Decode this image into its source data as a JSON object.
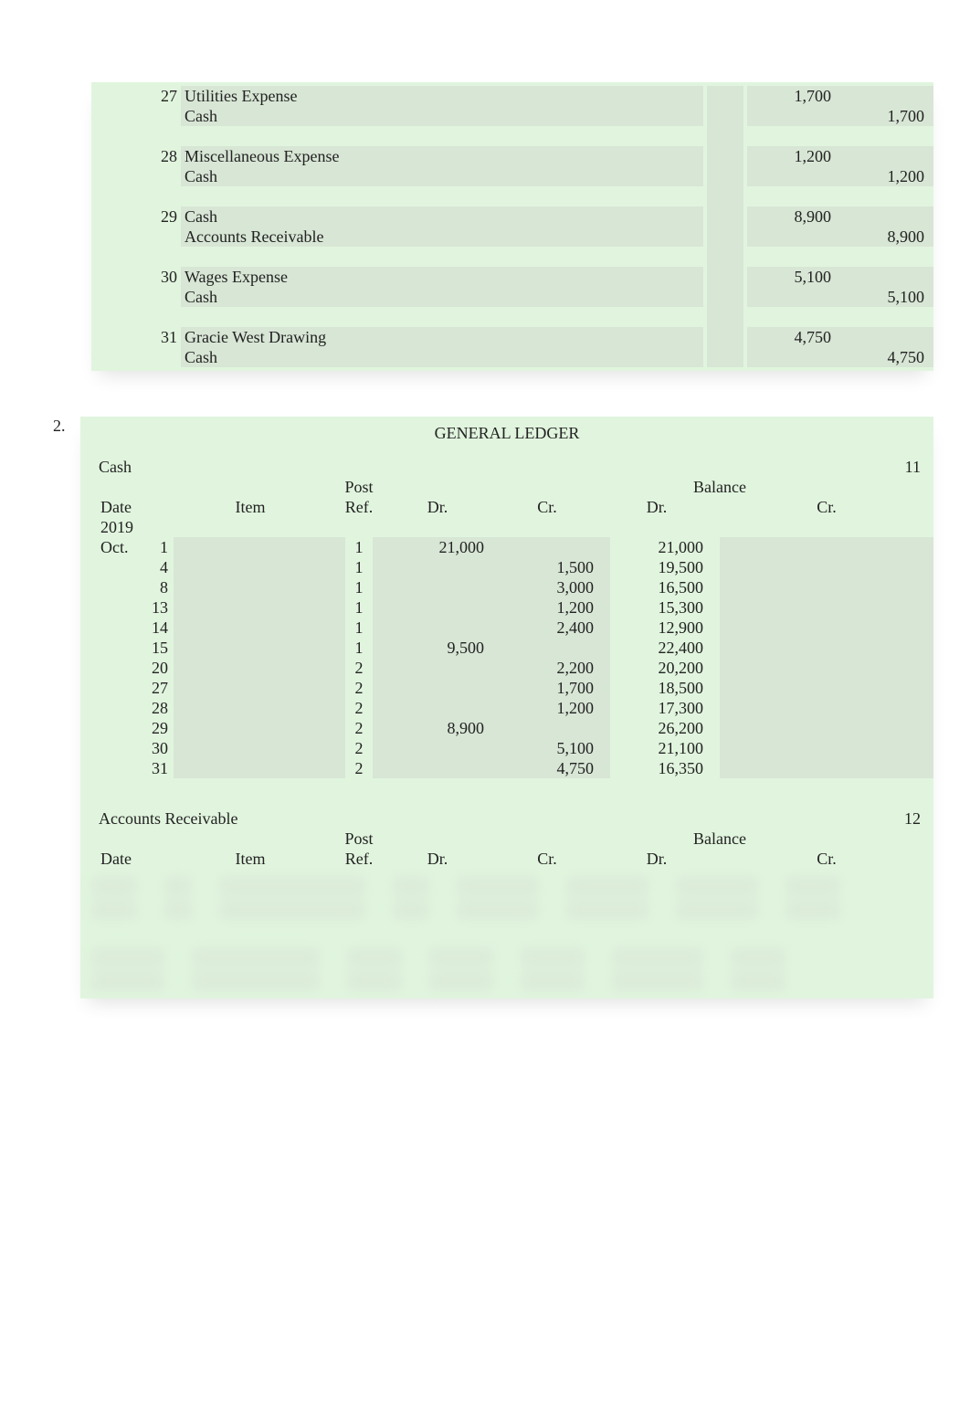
{
  "journal": {
    "entries": [
      {
        "day": "27",
        "debit_account": "Utilities Expense",
        "credit_account": "Cash",
        "amount_dr": "1,700",
        "amount_cr": "1,700"
      },
      {
        "day": "28",
        "debit_account": "Miscellaneous Expense",
        "credit_account": "Cash",
        "amount_dr": "1,200",
        "amount_cr": "1,200"
      },
      {
        "day": "29",
        "debit_account": "Cash",
        "credit_account": "Accounts Receivable",
        "amount_dr": "8,900",
        "amount_cr": "8,900"
      },
      {
        "day": "30",
        "debit_account": "Wages Expense",
        "credit_account": "Cash",
        "amount_dr": "5,100",
        "amount_cr": "5,100"
      },
      {
        "day": "31",
        "debit_account": "Gracie West Drawing",
        "credit_account": "Cash",
        "amount_dr": "4,750",
        "amount_cr": "4,750"
      }
    ]
  },
  "ledger": {
    "section_number": "2.",
    "title": "GENERAL LEDGER",
    "headers": {
      "date": "Date",
      "item": "Item",
      "post_ref": "Post Ref.",
      "post": "Post",
      "ref": "Ref.",
      "dr": "Dr.",
      "cr": "Cr.",
      "balance": "Balance"
    },
    "year": "2019",
    "month": "Oct.",
    "accounts": [
      {
        "name": "Cash",
        "number": "11",
        "rows": [
          {
            "day": "1",
            "ref": "1",
            "dr": "21,000",
            "cr": "",
            "bdr": "21,000",
            "bcr": ""
          },
          {
            "day": "4",
            "ref": "1",
            "dr": "",
            "cr": "1,500",
            "bdr": "19,500",
            "bcr": ""
          },
          {
            "day": "8",
            "ref": "1",
            "dr": "",
            "cr": "3,000",
            "bdr": "16,500",
            "bcr": ""
          },
          {
            "day": "13",
            "ref": "1",
            "dr": "",
            "cr": "1,200",
            "bdr": "15,300",
            "bcr": ""
          },
          {
            "day": "14",
            "ref": "1",
            "dr": "",
            "cr": "2,400",
            "bdr": "12,900",
            "bcr": ""
          },
          {
            "day": "15",
            "ref": "1",
            "dr": "9,500",
            "cr": "",
            "bdr": "22,400",
            "bcr": ""
          },
          {
            "day": "20",
            "ref": "2",
            "dr": "",
            "cr": "2,200",
            "bdr": "20,200",
            "bcr": ""
          },
          {
            "day": "27",
            "ref": "2",
            "dr": "",
            "cr": "1,700",
            "bdr": "18,500",
            "bcr": ""
          },
          {
            "day": "28",
            "ref": "2",
            "dr": "",
            "cr": "1,200",
            "bdr": "17,300",
            "bcr": ""
          },
          {
            "day": "29",
            "ref": "2",
            "dr": "8,900",
            "cr": "",
            "bdr": "26,200",
            "bcr": ""
          },
          {
            "day": "30",
            "ref": "2",
            "dr": "",
            "cr": "5,100",
            "bdr": "21,100",
            "bcr": ""
          },
          {
            "day": "31",
            "ref": "2",
            "dr": "",
            "cr": "4,750",
            "bdr": "16,350",
            "bcr": ""
          }
        ]
      },
      {
        "name": "Accounts Receivable",
        "number": "12",
        "rows": []
      }
    ]
  }
}
